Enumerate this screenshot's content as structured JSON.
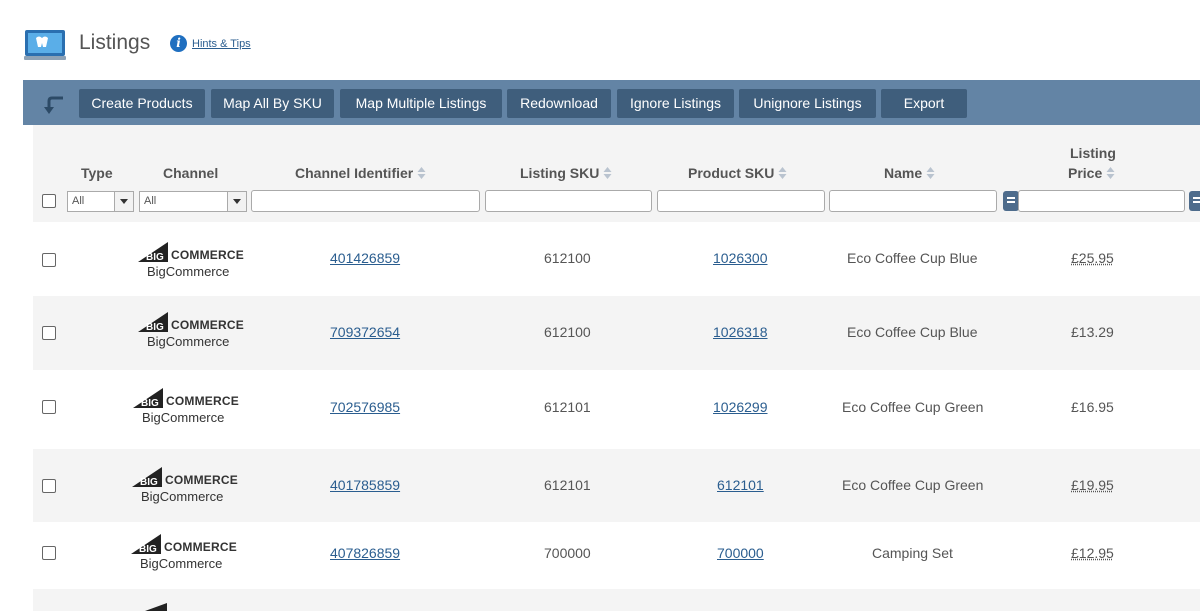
{
  "header": {
    "title": "Listings",
    "hints_label": "Hints & Tips"
  },
  "toolbar": {
    "buttons": [
      {
        "label": "Create Products"
      },
      {
        "label": "Map All By SKU"
      },
      {
        "label": "Map Multiple Listings"
      },
      {
        "label": "Redownload"
      },
      {
        "label": "Ignore Listings"
      },
      {
        "label": "Unignore Listings"
      },
      {
        "label": "Export"
      }
    ]
  },
  "table": {
    "columns": {
      "type": "Type",
      "channel": "Channel",
      "channel_identifier": "Channel Identifier",
      "listing_sku": "Listing SKU",
      "product_sku": "Product SKU",
      "name": "Name",
      "listing_price_line1": "Listing",
      "listing_price_line2": "Price"
    },
    "filters": {
      "type_value": "All",
      "channel_value": "All"
    },
    "rows": [
      {
        "channel_logo": "BIGCOMMERCE",
        "channel_logo_prefix": "BIG",
        "channel_logo_suffix": "COMMERCE",
        "channel": "BigCommerce",
        "channel_identifier": "401426859",
        "listing_sku": "612100",
        "product_sku": "1026300",
        "name": "Eco Coffee Cup Blue",
        "price": "£25.95"
      },
      {
        "channel_logo": "BIGCOMMERCE",
        "channel_logo_prefix": "BIG",
        "channel_logo_suffix": "COMMERCE",
        "channel": "BigCommerce",
        "channel_identifier": "709372654",
        "listing_sku": "612100",
        "product_sku": "1026318",
        "name": "Eco Coffee Cup Blue",
        "price": "£13.29"
      },
      {
        "channel_logo": "BIGCOMMERCE",
        "channel_logo_prefix": "BIG",
        "channel_logo_suffix": "COMMERCE",
        "channel": "BigCommerce",
        "channel_identifier": "702576985",
        "listing_sku": "612101",
        "product_sku": "1026299",
        "name": "Eco Coffee Cup Green",
        "price": "£16.95"
      },
      {
        "channel_logo": "BIGCOMMERCE",
        "channel_logo_prefix": "BIG",
        "channel_logo_suffix": "COMMERCE",
        "channel": "BigCommerce",
        "channel_identifier": "401785859",
        "listing_sku": "612101",
        "product_sku": "612101",
        "name": "Eco Coffee Cup Green",
        "price": "£19.95"
      },
      {
        "channel_logo": "BIGCOMMERCE",
        "channel_logo_prefix": "BIG",
        "channel_logo_suffix": "COMMERCE",
        "channel": "BigCommerce",
        "channel_identifier": "407826859",
        "listing_sku": "700000",
        "product_sku": "700000",
        "name": "Camping Set",
        "price": "£12.95"
      }
    ]
  },
  "colors": {
    "toolbar_bg": "#6384a5",
    "button_bg": "#3f5e7c",
    "link": "#2a5d8f",
    "alt_row": "#f4f4f4"
  },
  "icons": {
    "app": "laptop-icon",
    "info": "info-icon",
    "back": "back-arrow-icon",
    "sort": "sort-icon",
    "filter": "filter-icon"
  }
}
